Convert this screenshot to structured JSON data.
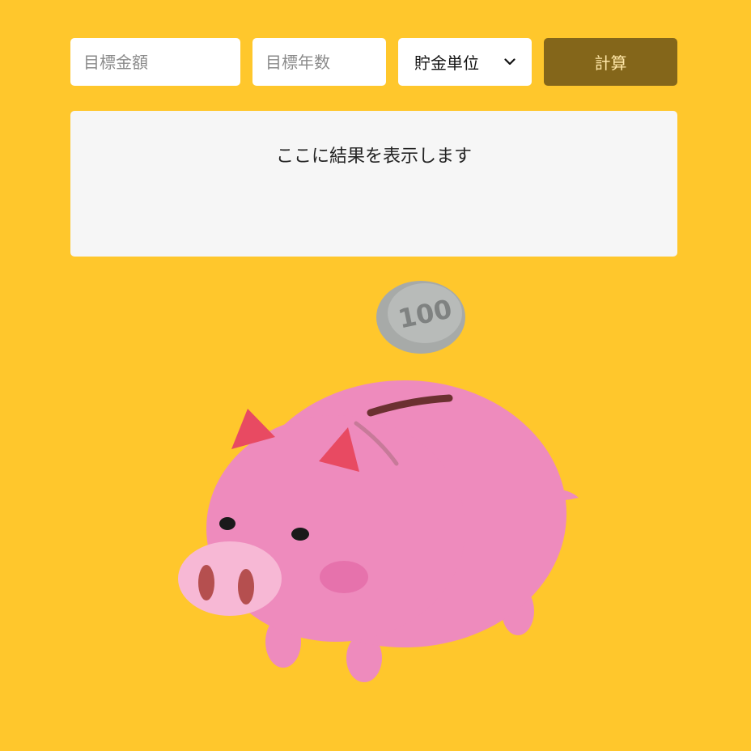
{
  "form": {
    "amount_placeholder": "目標金額",
    "years_placeholder": "目標年数",
    "unit_selected": "貯金単位",
    "calculate_label": "計算"
  },
  "result": {
    "text": "ここに結果を表示します"
  },
  "illustration": {
    "coin_label": "100",
    "icon": "piggy-bank-icon"
  },
  "colors": {
    "background": "#ffc72c",
    "button": "#84661a",
    "button_text": "#ffe7a8",
    "result_box": "#f6f6f6",
    "pig": "#ee8bbd",
    "coin": "#a7aaa8"
  }
}
